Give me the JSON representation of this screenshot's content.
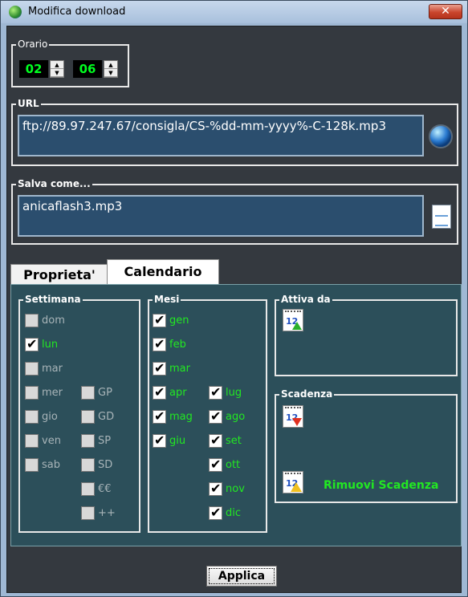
{
  "window": {
    "title": "Modifica download",
    "close_label": "✕"
  },
  "orario": {
    "label": "Orario",
    "hours": "02",
    "minutes": "06"
  },
  "url": {
    "label": "URL",
    "value": "ftp://89.97.247.67/consigla/CS-%dd-mm-yyyy%-C-128k.mp3"
  },
  "salva": {
    "label": "Salva come...",
    "value": "anicaflash3.mp3"
  },
  "tabs": [
    {
      "label": "Proprieta'"
    },
    {
      "label": "Calendario"
    }
  ],
  "settimana": {
    "label": "Settimana",
    "days": [
      {
        "label": "dom",
        "checked": false
      },
      {
        "label": "lun",
        "checked": true
      },
      {
        "label": "mar",
        "checked": false
      },
      {
        "label": "mer",
        "checked": false
      },
      {
        "label": "gio",
        "checked": false
      },
      {
        "label": "ven",
        "checked": false
      },
      {
        "label": "sab",
        "checked": false
      }
    ],
    "extra": [
      {
        "label": "GP",
        "checked": false
      },
      {
        "label": "GD",
        "checked": false
      },
      {
        "label": "SP",
        "checked": false
      },
      {
        "label": "SD",
        "checked": false
      },
      {
        "label": "€€",
        "checked": false
      },
      {
        "label": "++",
        "checked": false
      }
    ]
  },
  "mesi": {
    "label": "Mesi",
    "months": [
      {
        "label": "gen",
        "checked": true
      },
      {
        "label": "feb",
        "checked": true
      },
      {
        "label": "mar",
        "checked": true
      },
      {
        "label": "apr",
        "checked": true
      },
      {
        "label": "mag",
        "checked": true
      },
      {
        "label": "giu",
        "checked": true
      },
      {
        "label": "lug",
        "checked": true
      },
      {
        "label": "ago",
        "checked": true
      },
      {
        "label": "set",
        "checked": true
      },
      {
        "label": "ott",
        "checked": true
      },
      {
        "label": "nov",
        "checked": true
      },
      {
        "label": "dic",
        "checked": true
      }
    ]
  },
  "attiva_da": {
    "label": "Attiva da",
    "icon_num": "12"
  },
  "scadenza": {
    "label": "Scadenza",
    "icon_num": "12",
    "rimuovi_label": "Rimuovi Scadenza"
  },
  "buttons": {
    "applica": "Applica"
  },
  "icons": {
    "app": "globe-download-icon",
    "url_browse": "globe-icon",
    "save_browse": "file-icon",
    "attiva": "calendar-up-icon",
    "scadenza": "calendar-down-icon",
    "rimuovi": "calendar-warning-icon"
  }
}
